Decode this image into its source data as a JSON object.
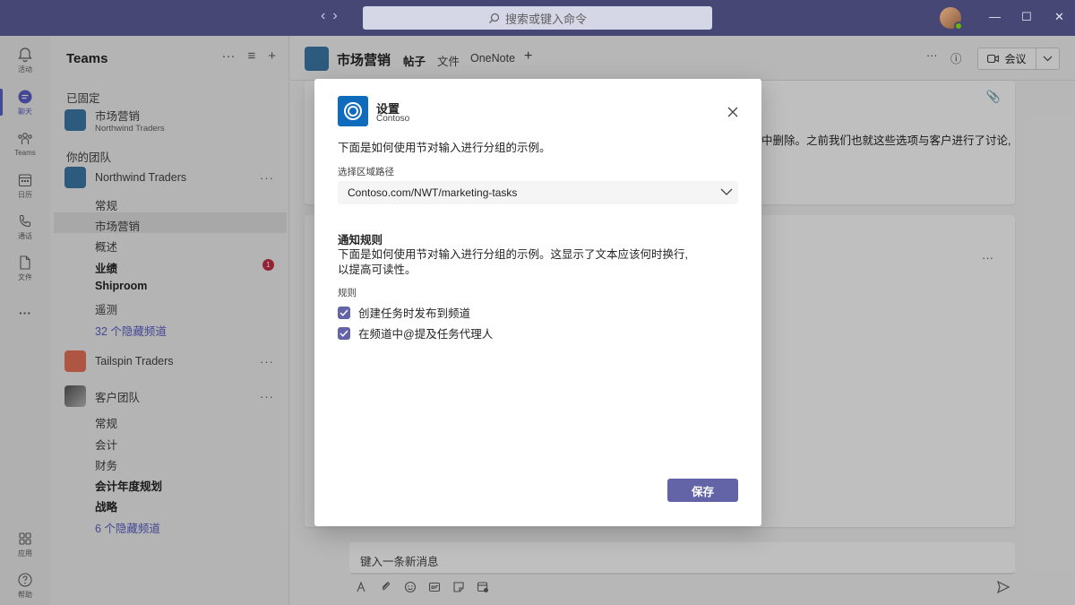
{
  "titlebar": {
    "search_placeholder": "搜索或键入命令"
  },
  "rail": {
    "items": [
      {
        "label": "活动",
        "icon": "bell-icon"
      },
      {
        "label": "聊天",
        "icon": "chat-icon"
      },
      {
        "label": "Teams",
        "icon": "teams-icon"
      },
      {
        "label": "日历",
        "icon": "calendar-icon"
      },
      {
        "label": "通话",
        "icon": "phone-icon"
      },
      {
        "label": "文件",
        "icon": "file-icon"
      },
      {
        "label": "应用",
        "icon": "apps-icon"
      },
      {
        "label": "帮助",
        "icon": "help-icon"
      }
    ],
    "more": "···"
  },
  "teams_panel": {
    "title": "Teams",
    "pinned_label": "已固定",
    "pinned_item": {
      "name": "市场营销",
      "sub": "Northwind Traders"
    },
    "your_teams_label": "你的团队",
    "teams": [
      {
        "name": "Northwind Traders",
        "channels": [
          "常规",
          "市场营销",
          "概述",
          "业绩",
          "Shiproom",
          "遥测"
        ],
        "hidden": "32 个隐藏频道",
        "badge": "1"
      },
      {
        "name": "Tailspin Traders"
      },
      {
        "name": "客户团队",
        "channels": [
          "常规",
          "会计",
          "财务",
          "会计年度规划",
          "战略"
        ],
        "hidden": "6 个隐藏频道"
      }
    ],
    "more": "···"
  },
  "channel_header": {
    "title": "市场营销",
    "tabs": [
      "帖子",
      "文件",
      "OneNote"
    ],
    "meeting_label": "会议"
  },
  "posts": {
    "snippet": "中删除。之前我们也就这些选项与客户进行了讨论,"
  },
  "compose": {
    "placeholder": "键入一条新消息"
  },
  "dialog": {
    "title": "设置",
    "subtitle": "Contoso",
    "intro": "下面是如何使用节对输入进行分组的示例。",
    "path_label": "选择区域路径",
    "path_value": "Contoso.com/NWT/marketing-tasks",
    "rules_heading": "通知规则",
    "rules_desc_1": "下面是如何使用节对输入进行分组的示例。这显示了文本应该何时换行,",
    "rules_desc_2": "以提高可读性。",
    "rules_label": "规则",
    "checks": [
      {
        "label": "创建任务时发布到频道",
        "checked": true
      },
      {
        "label": "在频道中@提及任务代理人",
        "checked": true
      }
    ],
    "save_label": "保存"
  },
  "colors": {
    "titlebar": "#464775",
    "accent": "#6264a7",
    "badge": "#c4314b"
  }
}
